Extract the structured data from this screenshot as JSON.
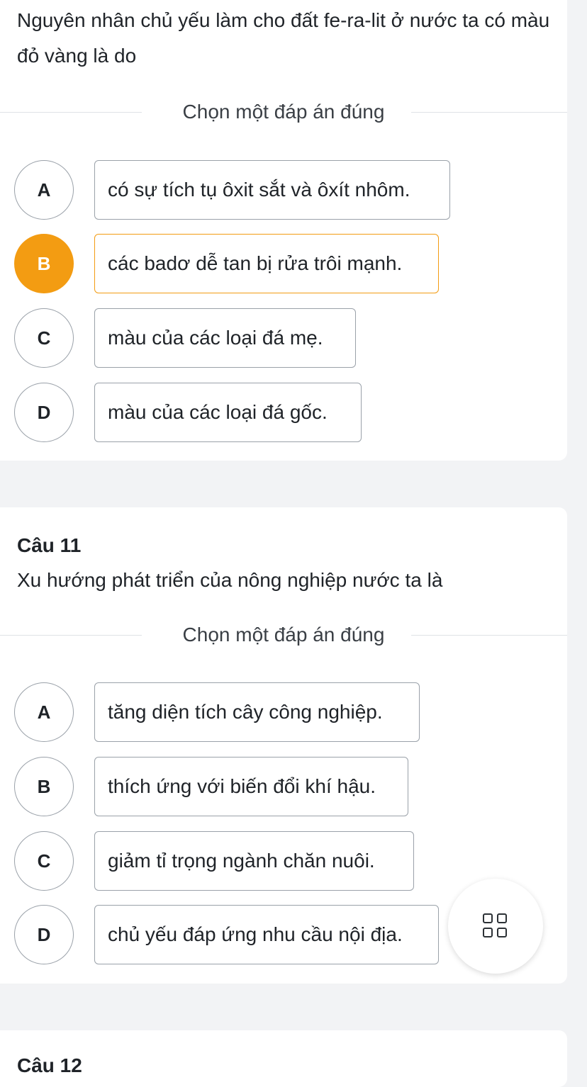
{
  "q10": {
    "text": "Nguyên nhân chủ yếu làm cho đất fe-ra-lit ở nước ta có màu đỏ vàng là do",
    "prompt": "Chọn một đáp án đúng",
    "options": [
      {
        "letter": "A",
        "text": "có sự tích tụ ôxit sắt và ôxít nhôm."
      },
      {
        "letter": "B",
        "text": "các badơ dễ tan bị rửa trôi mạnh."
      },
      {
        "letter": "C",
        "text": "màu của các loại đá mẹ."
      },
      {
        "letter": "D",
        "text": "màu của các loại đá gốc."
      }
    ],
    "selected": "B"
  },
  "q11": {
    "number": "Câu 11",
    "text": "Xu hướng phát triển của nông nghiệp nước ta là",
    "prompt": "Chọn một đáp án đúng",
    "options": [
      {
        "letter": "A",
        "text": "tăng diện tích cây công nghiệp."
      },
      {
        "letter": "B",
        "text": "thích ứng với biến đổi khí hậu."
      },
      {
        "letter": "C",
        "text": "giảm tỉ trọng ngành chăn nuôi."
      },
      {
        "letter": "D",
        "text": "chủ yếu đáp ứng nhu cầu nội địa."
      }
    ]
  },
  "q12": {
    "number": "Câu 12"
  },
  "fab": {
    "icon": "grid-icon"
  },
  "colors": {
    "accent": "#f39c12",
    "border": "#9aa1a9"
  }
}
